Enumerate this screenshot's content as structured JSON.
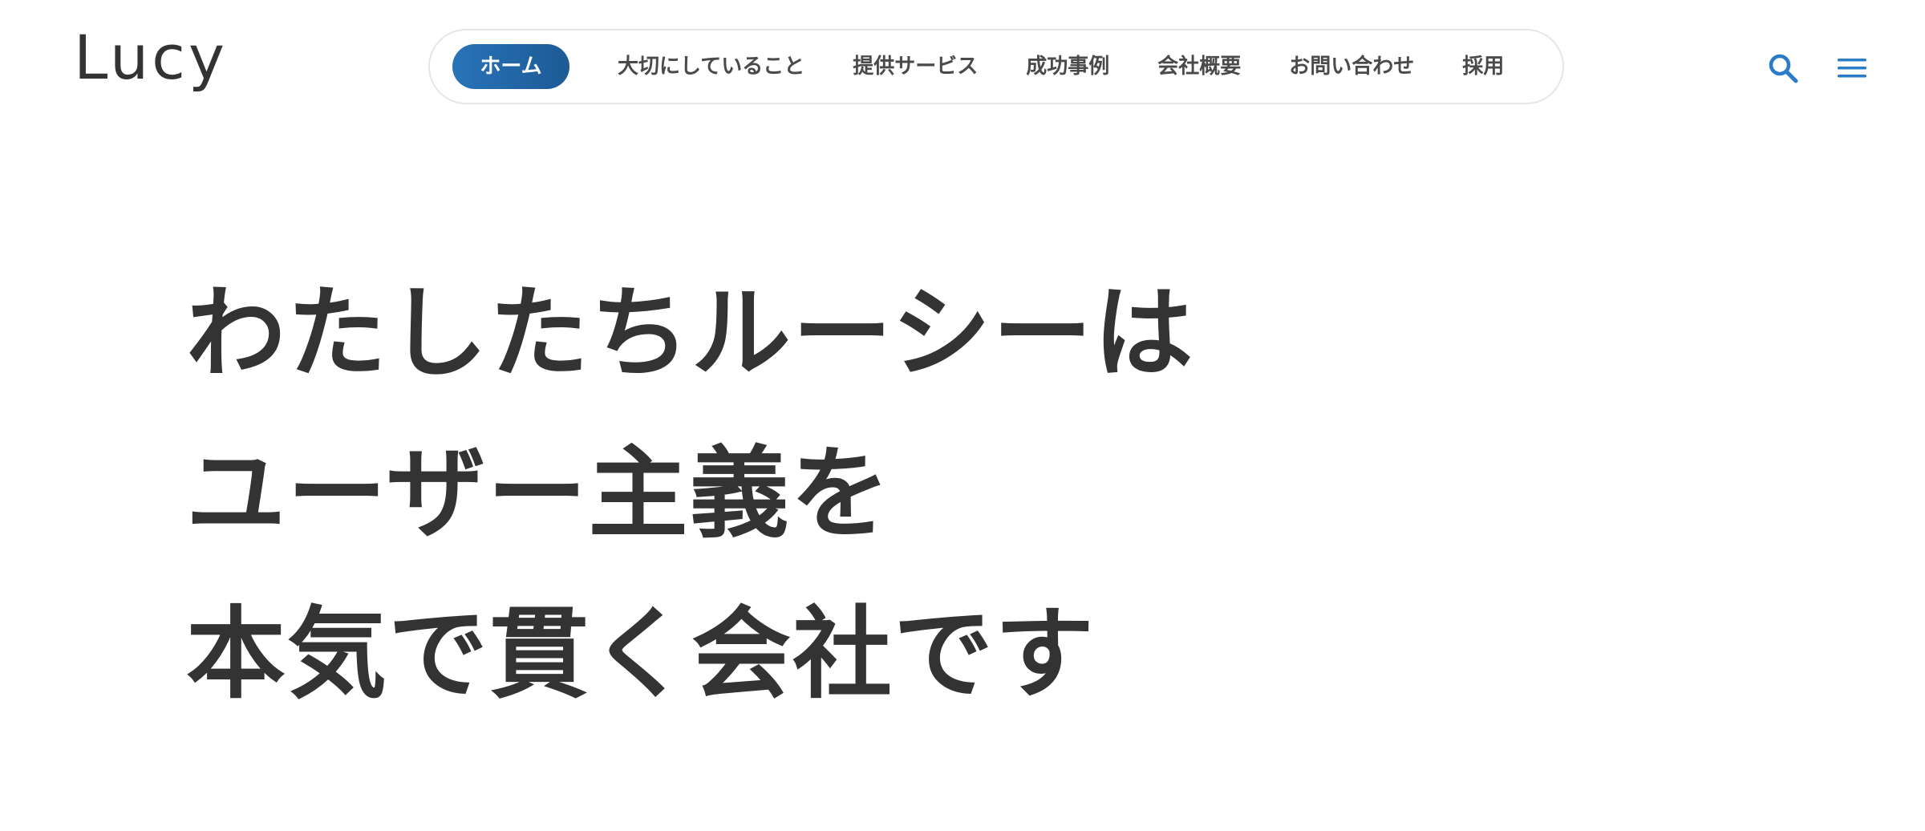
{
  "header": {
    "logo_text": "Lucy",
    "search_icon": "search-icon",
    "menu_icon": "hamburger-menu-icon",
    "accent_color": "#2a7bc8"
  },
  "nav": {
    "items": [
      {
        "label": "ホーム",
        "active": true
      },
      {
        "label": "大切にしていること",
        "active": false
      },
      {
        "label": "提供サービス",
        "active": false
      },
      {
        "label": "成功事例",
        "active": false
      },
      {
        "label": "会社概要",
        "active": false
      },
      {
        "label": "お問い合わせ",
        "active": false
      },
      {
        "label": "採用",
        "active": false
      }
    ]
  },
  "hero": {
    "lines": [
      "わたしたちルーシーは",
      "ユーザー主義を",
      "本気で貫く会社です"
    ]
  }
}
